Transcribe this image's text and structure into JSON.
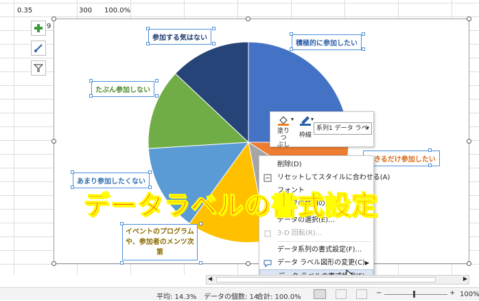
{
  "top_cells": [
    "0.35",
    "300",
    "100.0%"
  ],
  "row_digit": "9",
  "chart": {
    "slices": [
      {
        "label": "積極的に参加したい",
        "color": "#4472c4",
        "share": 0.25
      },
      {
        "label": "できるだけ参加したい",
        "color": "#ed7d31",
        "share": 0.09
      },
      {
        "label": "",
        "color": "#a5a5a5",
        "share": 0.13
      },
      {
        "label": "イベントのプログラムや、参加者のメンツ次第",
        "color": "#ffc000",
        "share": 0.13
      },
      {
        "label": "あまり参加したくない",
        "color": "#5b9bd5",
        "share": 0.14
      },
      {
        "label": "たぶん参加しない",
        "color": "#70ad47",
        "share": 0.13
      },
      {
        "label": "参加する気はない",
        "color": "#264478",
        "share": 0.13
      }
    ],
    "labels": {
      "l1": "積極的に参加したい",
      "l2": "できるだけ参加したい",
      "l4a": "イベントのプログラム",
      "l4b": "や、参加者のメンツ次",
      "l4c": "第",
      "l5": "あまり参加したくない",
      "l6": "たぶん参加しない",
      "l7": "参加する気はない"
    }
  },
  "mini_toolbar": {
    "fill_label_1": "塗りつ",
    "fill_label_2": "ぶし",
    "outline_label": "枠線",
    "series_select": "系列1 データ ラベ"
  },
  "context_menu": {
    "items": [
      {
        "label": "削除(D)",
        "disabled": false
      },
      {
        "label": "リセットしてスタイルに合わせる(A)",
        "disabled": false
      },
      {
        "label": "フォント",
        "disabled": false
      },
      {
        "label": "グラフの種類の変更",
        "disabled": false
      },
      {
        "label": "データの選択(E)...",
        "disabled": false
      },
      {
        "label": "3-D 回転(R)...",
        "disabled": true
      },
      {
        "label": "データ系列の書式設定(F)...",
        "disabled": false
      },
      {
        "label": "データ ラベル図形の変更(C)",
        "disabled": false
      },
      {
        "label": "データ ラベルの書式設定(F)...",
        "disabled": false
      }
    ]
  },
  "overlay_caption": "データラベルの書式設定",
  "status_bar": {
    "average": "平均: 14.3%",
    "count": "データの個数: 14",
    "sum": "合計: 100.0%",
    "zoom": "100%",
    "minus": "−",
    "plus": "+"
  },
  "colors": {
    "accent": "#4a90d9",
    "overlay_text": "#ff2020",
    "overlay_stroke": "#ffff00"
  }
}
